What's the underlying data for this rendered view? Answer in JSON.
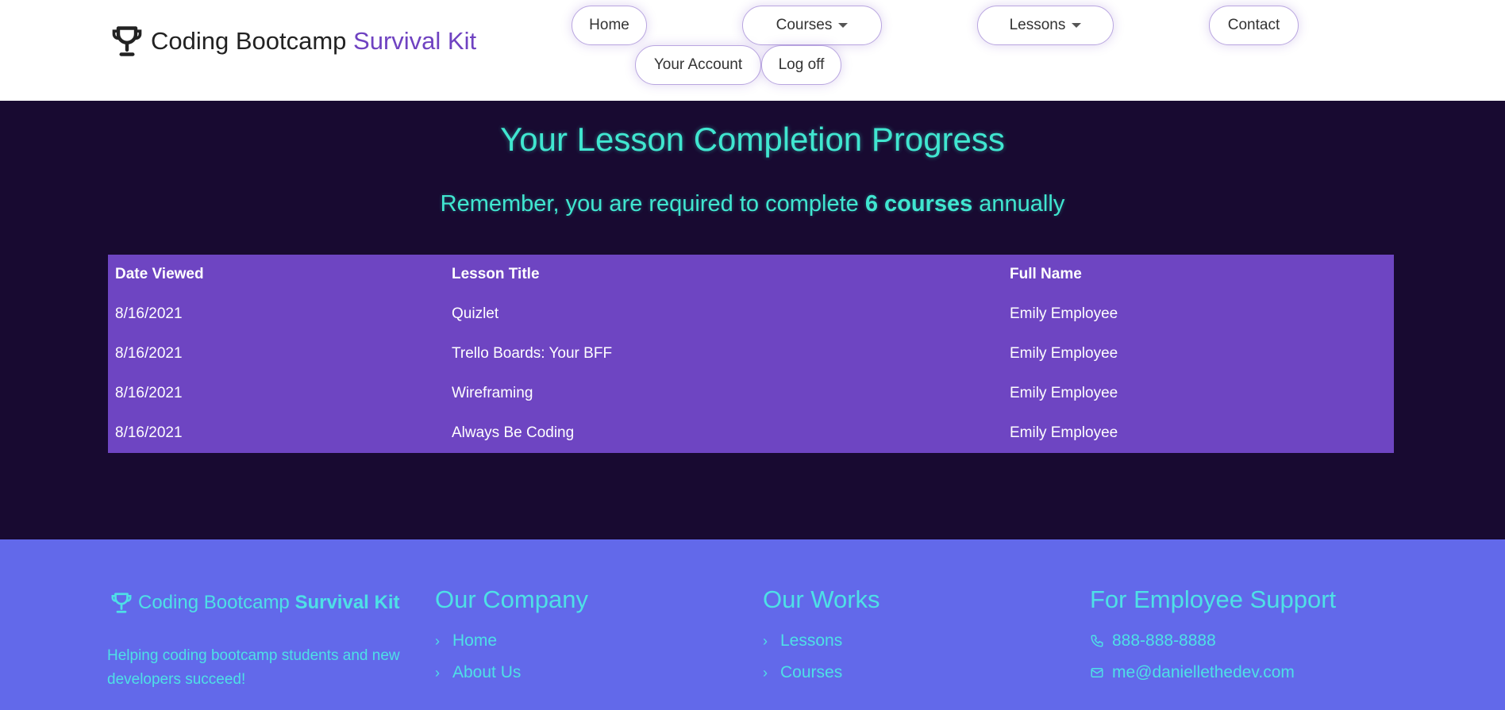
{
  "header": {
    "brand_main": "Coding Bootcamp ",
    "brand_accent": "Survival Kit",
    "nav": {
      "home": "Home",
      "courses": "Courses",
      "lessons": "Lessons",
      "contact": "Contact",
      "account": "Your Account",
      "logoff": "Log off"
    }
  },
  "main": {
    "title": "Your Lesson Completion Progress",
    "subtitle_pre": "Remember, you are required to complete ",
    "subtitle_bold": "6 courses",
    "subtitle_post": " annually",
    "table": {
      "columns": [
        "Date Viewed",
        "Lesson Title",
        "Full Name"
      ],
      "rows": [
        [
          "8/16/2021",
          "Quizlet",
          "Emily Employee"
        ],
        [
          "8/16/2021",
          "Trello Boards: Your BFF",
          "Emily Employee"
        ],
        [
          "8/16/2021",
          "Wireframing",
          "Emily Employee"
        ],
        [
          "8/16/2021",
          "Always Be Coding",
          "Emily Employee"
        ]
      ]
    }
  },
  "footer": {
    "brand_main": "Coding Bootcamp ",
    "brand_bold": "Survival Kit",
    "tagline": "Helping coding bootcamp students and new developers succeed!",
    "company": {
      "heading": "Our Company",
      "links": [
        "Home",
        "About Us"
      ]
    },
    "works": {
      "heading": "Our Works",
      "links": [
        "Lessons",
        "Courses"
      ]
    },
    "support": {
      "heading": "For Employee Support",
      "phone": "888-888-8888",
      "email": "me@daniellethedev.com"
    }
  },
  "colors": {
    "accent_purple": "#6f42c1",
    "main_bg": "#180a31",
    "table_bg": "#6e45c2",
    "heading_teal": "#40e6d0",
    "footer_bg": "#6269ea"
  },
  "icons": [
    "trophy-icon",
    "chevron-right-icon",
    "phone-icon",
    "email-icon",
    "caret-down-icon"
  ]
}
